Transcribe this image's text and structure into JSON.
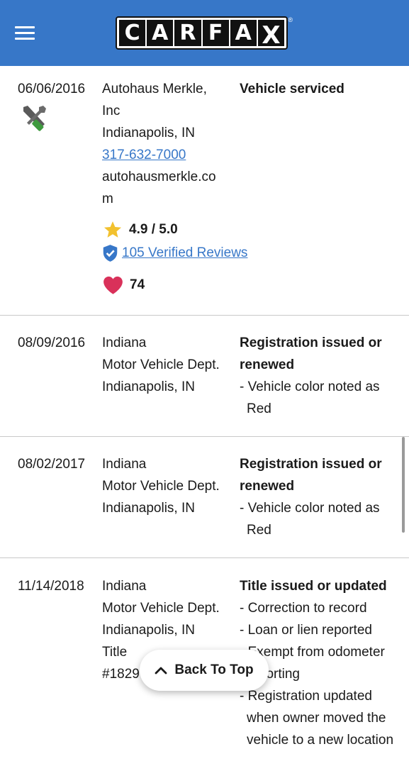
{
  "header": {
    "menu_icon": "hamburger-menu-icon",
    "logo_letters": [
      "C",
      "A",
      "R",
      "F",
      "A",
      "X"
    ],
    "logo_reg": "®",
    "bg_color": "#3777c8"
  },
  "records": [
    {
      "date": "06/06/2016",
      "icon": "service-tools-icon",
      "source_lines": [
        "Autohaus Merkle,",
        "Inc",
        "Indianapolis, IN"
      ],
      "phone": "317-632-7000",
      "website_lines": [
        "autohausmerkle.co",
        "m"
      ],
      "rating": "4.9 / 5.0",
      "reviews": "105 Verified Reviews",
      "favorites": "74",
      "title": "Vehicle serviced",
      "details": []
    },
    {
      "date": "08/09/2016",
      "source_lines": [
        "Indiana",
        "Motor Vehicle Dept.",
        "Indianapolis, IN"
      ],
      "title_lines": [
        "Registration issued or",
        "renewed"
      ],
      "details": [
        "- Vehicle color noted as Red"
      ]
    },
    {
      "date": "08/02/2017",
      "source_lines": [
        "Indiana",
        "Motor Vehicle Dept.",
        "Indianapolis, IN"
      ],
      "title_lines": [
        "Registration issued or",
        "renewed"
      ],
      "details": [
        "- Vehicle color noted as Red"
      ]
    },
    {
      "date": "11/14/2018",
      "source_lines": [
        "Indiana",
        "Motor Vehicle Dept.",
        "Indianapolis, IN",
        "Title",
        "#1829"
      ],
      "title": "Title issued or updated",
      "details": [
        "- Correction to record",
        "- Loan or lien reported",
        "- Exempt from odometer reporting",
        "- Registration updated when owner moved the vehicle to a new location"
      ]
    }
  ],
  "back_to_top": {
    "label": "Back To Top",
    "icon": "chevron-up-icon"
  },
  "colors": {
    "accent": "#3777c8",
    "star": "#f2c12e",
    "heart": "#d9315a",
    "shield": "#3777c8"
  }
}
